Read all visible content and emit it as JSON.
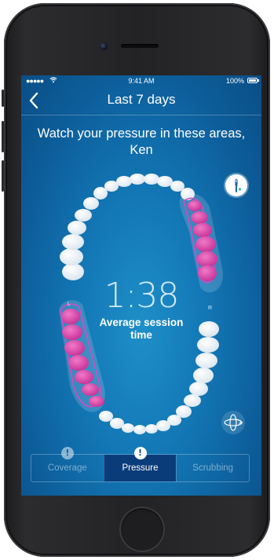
{
  "status_bar": {
    "signal": "●●●●●",
    "wifi_icon": "wifi-icon",
    "time": "9:41 AM",
    "battery": "100%"
  },
  "nav": {
    "back_icon": "chevron-left-icon",
    "title": "Last 7 days"
  },
  "headline": "Watch your pressure in these areas, Ken",
  "session": {
    "time": "1:38",
    "label": "Average session time"
  },
  "jaw_labels": {
    "left": "L",
    "right": "R"
  },
  "tabs": [
    {
      "label": "Coverage",
      "alert": "!",
      "active": false
    },
    {
      "label": "Pressure",
      "alert": "!",
      "active": true
    },
    {
      "label": "Scrubbing",
      "active": false
    }
  ],
  "colors": {
    "background": "#1377b5",
    "highlight_tooth": "#e23fa8",
    "active_tab": "#0b3c7a"
  }
}
